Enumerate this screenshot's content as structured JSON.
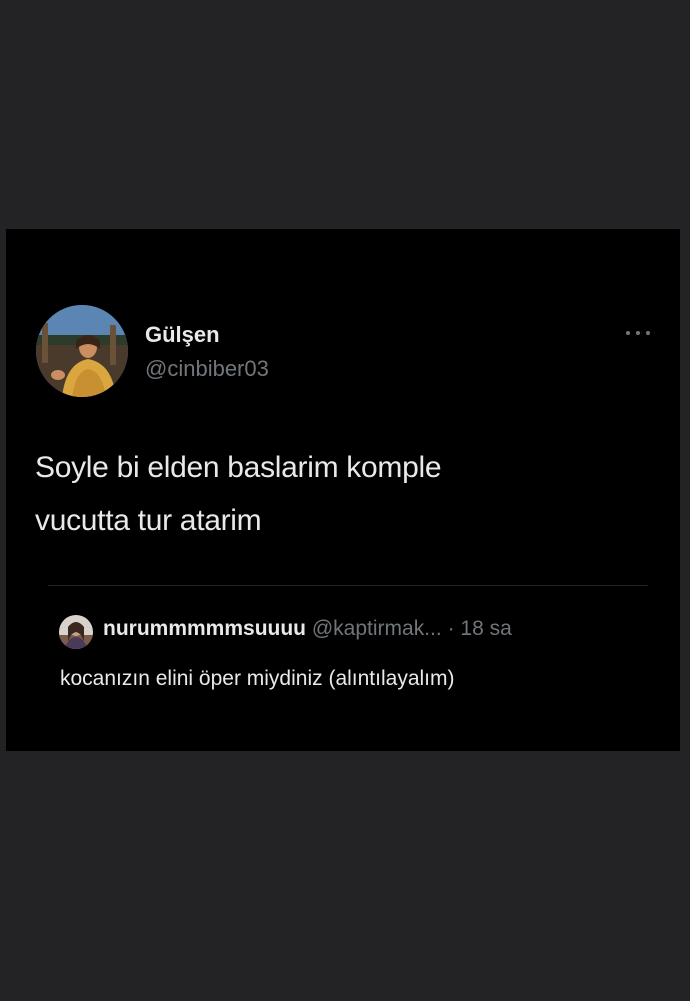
{
  "tweet": {
    "author": {
      "display_name": "Gülşen",
      "handle": "@cinbiber03"
    },
    "text_line1": "Soyle bi elden baslarim komple",
    "text_line2": "vucutta tur atarim",
    "more_icon": "ellipsis-icon"
  },
  "quoted_tweet": {
    "display_name": "nurummmmmsuuuu",
    "handle": "@kaptirmak...",
    "separator": "·",
    "time": "18 sa",
    "text": "kocanızın elini öper miydiniz (alıntılayalım)"
  },
  "colors": {
    "background": "#232225",
    "card": "#000000",
    "text_primary": "#e7e9ea",
    "text_secondary": "#71767b"
  }
}
